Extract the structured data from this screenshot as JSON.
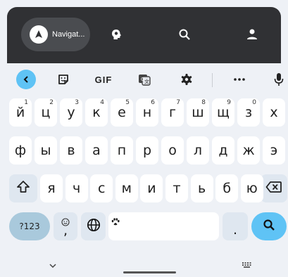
{
  "topbar": {
    "nav_label": "Navigat...",
    "icons": [
      "navigation-icon",
      "head-idea-icon",
      "search-icon",
      "account-icon"
    ]
  },
  "toolbar": {
    "gif_label": "GIF",
    "icons": [
      "back-icon",
      "sticker-icon",
      "translate-icon",
      "gear-icon",
      "more-icon",
      "mic-icon"
    ]
  },
  "rows": {
    "row1": [
      {
        "label": "й",
        "hint": "1"
      },
      {
        "label": "ц",
        "hint": "2"
      },
      {
        "label": "у",
        "hint": "3"
      },
      {
        "label": "к",
        "hint": "4"
      },
      {
        "label": "е",
        "hint": "5"
      },
      {
        "label": "н",
        "hint": "6"
      },
      {
        "label": "г",
        "hint": "7"
      },
      {
        "label": "ш",
        "hint": "8"
      },
      {
        "label": "щ",
        "hint": "9"
      },
      {
        "label": "з",
        "hint": "0"
      },
      {
        "label": "х",
        "hint": ""
      }
    ],
    "row2": [
      "ф",
      "ы",
      "в",
      "а",
      "п",
      "р",
      "о",
      "л",
      "д",
      "ж",
      "э"
    ],
    "row3": [
      "я",
      "ч",
      "с",
      "м",
      "и",
      "т",
      "ь",
      "б",
      "ю"
    ]
  },
  "bottom_row": {
    "symbols_label": "?123",
    "comma_label": ",",
    "period_label": "."
  },
  "colors": {
    "accent": "#5fc3f5",
    "topbar_bg": "#303134",
    "keyboard_bg": "#eef1f6"
  }
}
